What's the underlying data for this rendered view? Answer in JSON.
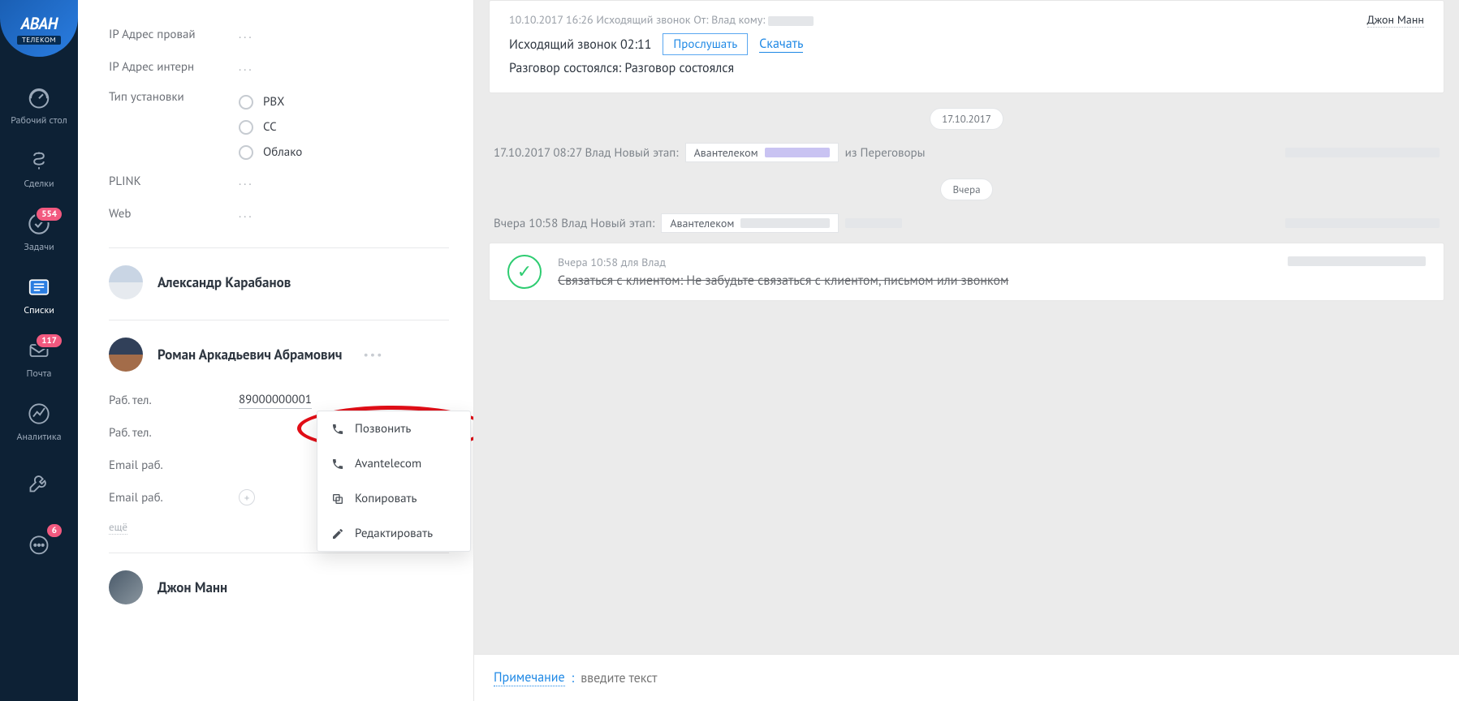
{
  "logo": {
    "main": "АВАН",
    "sub": "ТЕЛЕКОМ"
  },
  "nav": {
    "desk": "Рабочий стол",
    "deals": "Сделки",
    "tasks": "Задачи",
    "tasks_badge": "554",
    "lists": "Списки",
    "mail": "Почта",
    "mail_badge": "117",
    "analytics": "Аналитика",
    "settings_badge": "6"
  },
  "leftPanel": {
    "ip_provider_label": "IP Адрес провай",
    "ip_provider_value": "...",
    "ip_internal_label": "IP Адрес интерн",
    "ip_internal_value": "...",
    "install_type_label": "Тип установки",
    "install_options": {
      "pbx": "PBX",
      "cc": "CC",
      "cloud": "Облако"
    },
    "plink_label": "PLINK",
    "plink_value": "...",
    "web_label": "Web",
    "web_value": "...",
    "contact1": "Александр  Карабанов",
    "contact2": "Роман Аркадьевич Абрамович",
    "work_phone_label": "Раб. тел.",
    "work_phone_value": "89000000001",
    "work_phone_label2": "Раб. тел.",
    "email_label1": "Email раб.",
    "email_label2": "Email раб.",
    "more_link": "ещё",
    "contact3": "Джон Манн"
  },
  "popup": {
    "call": "Позвонить",
    "avantelecom": "Avantelecom",
    "copy": "Копировать",
    "edit": "Редактировать"
  },
  "timeline": {
    "event1": {
      "meta": "10.10.2017 16:26 Исходящий звонок От: Влад кому: ",
      "line1a": "Исходящий звонок 02:11",
      "listen": "Прослушать",
      "download": "Скачать",
      "line2": "Разговор состоялся: Разговор состоялся",
      "author": "Джон Манн"
    },
    "date1": "17.10.2017",
    "stage1_prefix": "17.10.2017 08:27 Влад Новый этап:",
    "stage1_box": "Авантелеком",
    "stage1_suffix": "из Переговоры",
    "date2": "Вчера",
    "stage2_prefix": "Вчера 10:58 Влад Новый этап:",
    "stage2_box": "Авантелеком",
    "task": {
      "meta": "Вчера 10:58 для Влад",
      "text": "Связаться с клиентом: Не забудьте связаться с клиентом, письмом или звонком"
    }
  },
  "noteBar": {
    "label": "Примечание",
    "colon": ":",
    "placeholder": "введите текст"
  }
}
